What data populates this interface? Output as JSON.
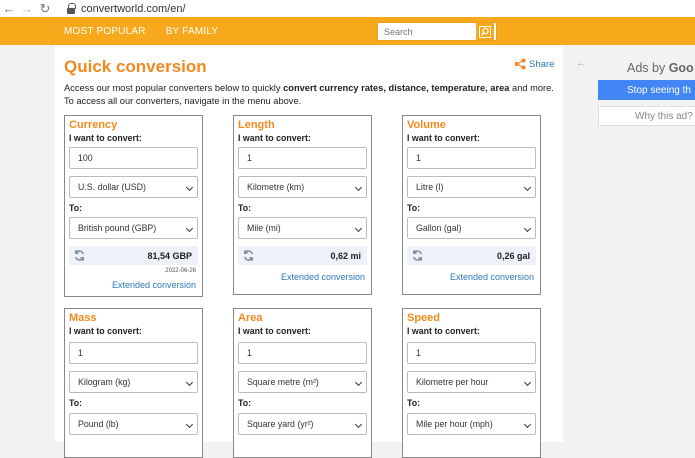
{
  "browser": {
    "back": "←",
    "forward": "→",
    "reload": "↻",
    "url": "convertworld.com/en/"
  },
  "nav": {
    "links": [
      "MOST POPULAR",
      "BY FAMILY"
    ],
    "search_placeholder": "Search"
  },
  "main": {
    "title": "Quick conversion",
    "share": "Share",
    "intro_1": "Access our most popular converters below to quickly ",
    "intro_bold": "convert currency rates, distance, temperature, area",
    "intro_2": " and more.",
    "intro_3": "To access all our converters, navigate in the menu above."
  },
  "cards": [
    {
      "title": "Currency",
      "convert_label": "I want to convert:",
      "amount": "100",
      "from": "U.S. dollar (USD)",
      "to_label": "To:",
      "to": "British pound (GBP)",
      "result": "81,54 GBP",
      "date": "2022-06-26",
      "link": "Extended conversion"
    },
    {
      "title": "Length",
      "convert_label": "I want to convert:",
      "amount": "1",
      "from": "Kilometre (km)",
      "to_label": "To:",
      "to": "Mile (mi)",
      "result": "0,62 mi",
      "link": "Extended conversion"
    },
    {
      "title": "Volume",
      "convert_label": "I want to convert:",
      "amount": "1",
      "from": "Litre (l)",
      "to_label": "To:",
      "to": "Gallon (gal)",
      "result": "0,26 gal",
      "link": "Extended conversion"
    },
    {
      "title": "Mass",
      "convert_label": "I want to convert:",
      "amount": "1",
      "from": "Kilogram (kg)",
      "to_label": "To:",
      "to": "Pound (lb)"
    },
    {
      "title": "Area",
      "convert_label": "I want to convert:",
      "amount": "1",
      "from": "Square metre (m²)",
      "to_label": "To:",
      "to": "Square yard (yr²)"
    },
    {
      "title": "Speed",
      "convert_label": "I want to convert:",
      "amount": "1",
      "from": "Kilometre per hour",
      "to_label": "To:",
      "to": "Mile per hour (mph)"
    }
  ],
  "ads": {
    "arrow": "←",
    "ads_by": "Ads by ",
    "brand": "Goo",
    "stop": "Stop seeing th",
    "why": "Why this ad?"
  },
  "colors": {
    "nav_bg": "#f7a81b",
    "title_orange": "#f0891e",
    "link_blue": "#2a7ab8",
    "ad_blue": "#4285f4"
  }
}
